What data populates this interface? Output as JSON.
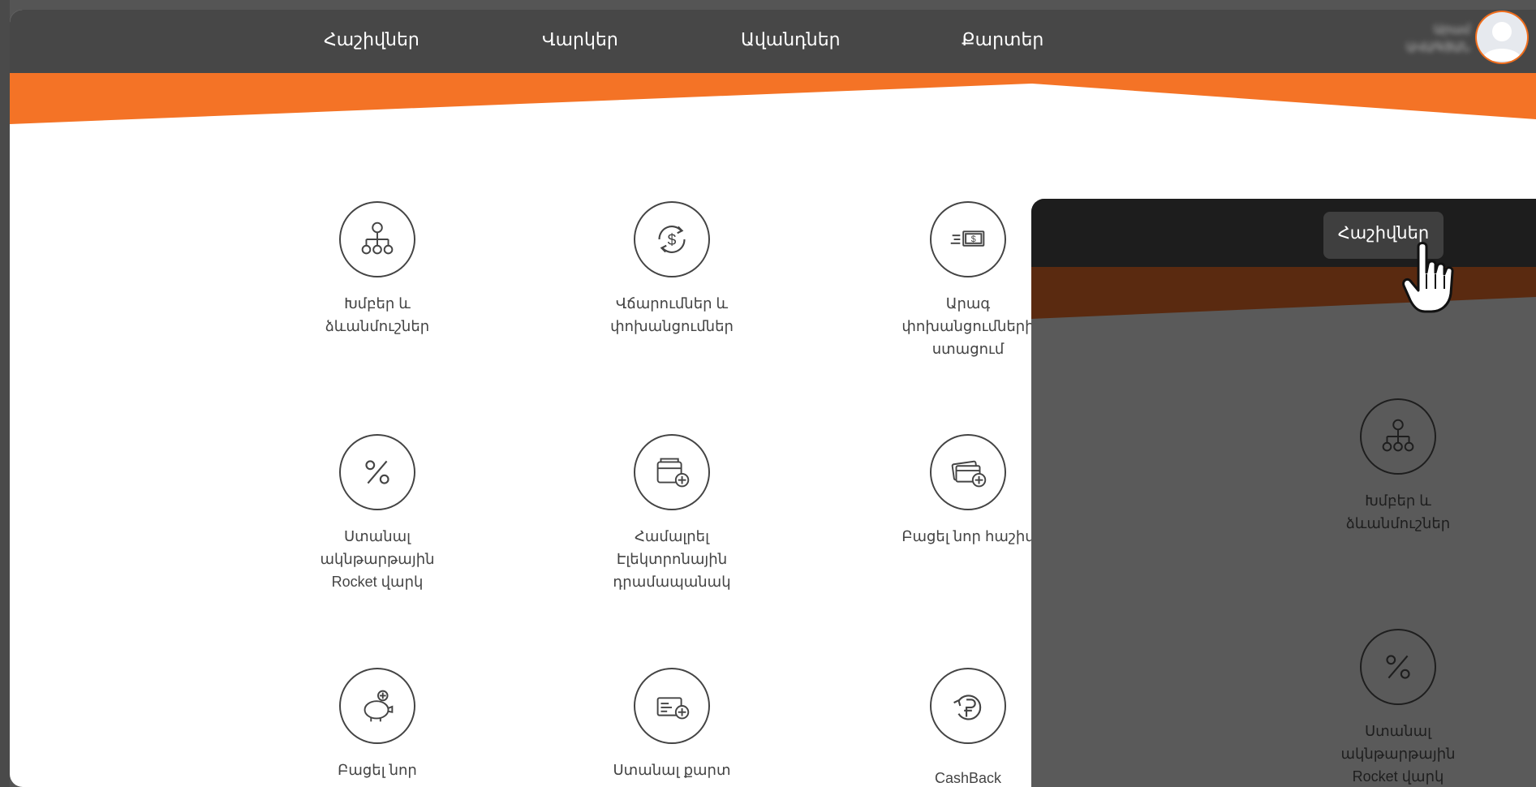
{
  "nav": {
    "items": [
      "Հաշիվներ",
      "Վարկեր",
      "Ավանդներ",
      "Քարտեր"
    ]
  },
  "user": {
    "name_line1": "Արամ",
    "name_line2": "ԱՎԱԳՅԱՆ"
  },
  "tiles": [
    {
      "icon": "hierarchy-icon",
      "label": "Խմբեր և ձևանմուշներ"
    },
    {
      "icon": "currency-exchange-icon",
      "label": "Վճարումներ և փոխանցումներ"
    },
    {
      "icon": "fast-transfer-icon",
      "label": "Արագ փոխանցումների ստացում"
    },
    {
      "icon": "percent-icon",
      "label": "Ստանալ ակնթարթային Rocket վարկ"
    },
    {
      "icon": "wallet-add-icon",
      "label": "Համալրել Էլեկտրոնային դրամապանակ"
    },
    {
      "icon": "card-add-icon",
      "label": "Բացել նոր հաշիվ"
    },
    {
      "icon": "piggy-bank-icon",
      "label": "Բացել նոր"
    },
    {
      "icon": "card-request-icon",
      "label": "Ստանալ քարտ"
    },
    {
      "icon": "cashback-icon",
      "label": "CashBack"
    }
  ],
  "overlay": {
    "button_label": "Հաշիվներ",
    "tiles": [
      {
        "icon": "hierarchy-icon",
        "label": "Խմբեր և ձևանմուշներ"
      },
      {
        "icon": "percent-icon",
        "label": "Ստանալ ակնթարթային Rocket վարկ"
      }
    ]
  },
  "colors": {
    "accent": "#f47326",
    "topbar": "#474747",
    "overlay_bar": "#1d1d1d"
  }
}
